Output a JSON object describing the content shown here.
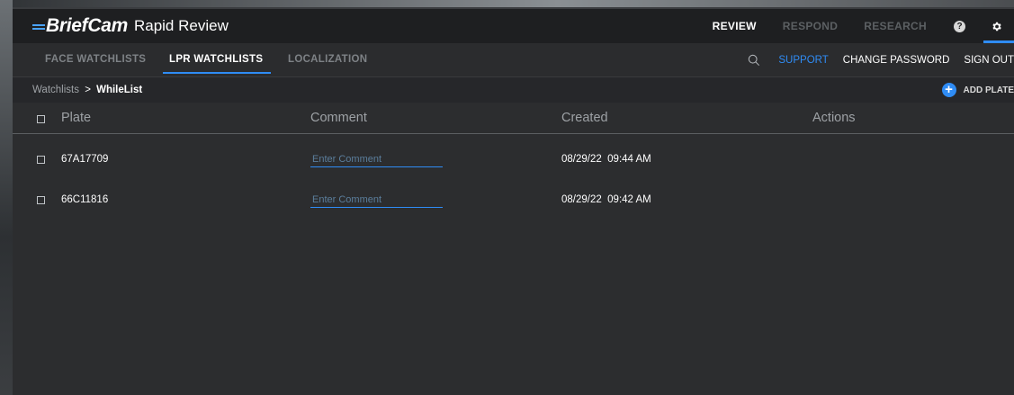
{
  "app": {
    "brand": "BriefCam",
    "product": "Rapid Review"
  },
  "top_nav": {
    "items": [
      {
        "label": "REVIEW",
        "active": true
      },
      {
        "label": "RESPOND",
        "active": false
      },
      {
        "label": "RESEARCH",
        "active": false
      }
    ],
    "help_icon": "question-circle-icon",
    "help_glyph": "?",
    "settings_icon": "gear-icon"
  },
  "sub_nav": {
    "tabs": [
      {
        "label": "FACE WATCHLISTS",
        "active": false
      },
      {
        "label": "LPR WATCHLISTS",
        "active": true
      },
      {
        "label": "LOCALIZATION",
        "active": false
      }
    ],
    "search_icon": "search-icon",
    "links": {
      "support": "SUPPORT",
      "change_password": "CHANGE PASSWORD",
      "sign_out": "SIGN OUT"
    }
  },
  "breadcrumb": {
    "root": "Watchlists",
    "separator": ">",
    "current": "WhileList"
  },
  "add_plate": {
    "icon": "plus-circle-icon",
    "glyph": "+",
    "label": "ADD PLATE"
  },
  "table": {
    "columns": [
      "Plate",
      "Comment",
      "Created",
      "Actions"
    ],
    "rows": [
      {
        "plate": "67A17709",
        "comment_placeholder": "Enter Comment",
        "created": "08/29/22  09:44 AM"
      },
      {
        "plate": "66C11816",
        "comment_placeholder": "Enter Comment",
        "created": "08/29/22  09:42 AM"
      }
    ]
  },
  "colors": {
    "accent": "#2f8cf5",
    "topbar_bg": "#1e1f21",
    "content_bg": "#2c2d2f"
  }
}
